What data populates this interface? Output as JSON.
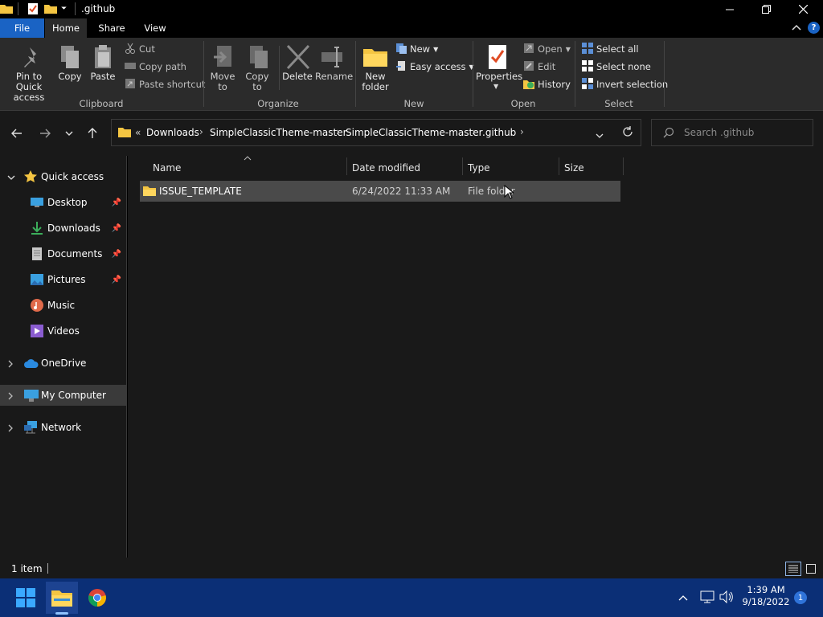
{
  "window": {
    "title": ".github"
  },
  "ribbon_tabs": {
    "file": "File",
    "home": "Home",
    "share": "Share",
    "view": "View"
  },
  "ribbon": {
    "clipboard": {
      "group": "Clipboard",
      "pin": "Pin to Quick access",
      "pin_l1": "Pin to Quick",
      "pin_l2": "access",
      "copy": "Copy",
      "paste": "Paste",
      "cut": "Cut",
      "copy_path": "Copy path",
      "paste_shortcut": "Paste shortcut"
    },
    "organize": {
      "group": "Organize",
      "move_l1": "Move",
      "move_l2": "to",
      "copy_l1": "Copy",
      "copy_l2": "to",
      "delete": "Delete",
      "rename": "Rename"
    },
    "new": {
      "group": "New",
      "new_folder_l1": "New",
      "new_folder_l2": "folder",
      "new_item": "New",
      "easy_access": "Easy access"
    },
    "open": {
      "group": "Open",
      "properties": "Properties",
      "open": "Open",
      "edit": "Edit",
      "history": "History"
    },
    "select": {
      "group": "Select",
      "select_all": "Select all",
      "select_none": "Select none",
      "invert": "Invert selection"
    }
  },
  "address": {
    "crumbs": [
      "Downloads",
      "SimpleClassicTheme-master",
      "SimpleClassicTheme-master",
      ".github"
    ],
    "overflow": "«"
  },
  "search": {
    "placeholder": "Search .github"
  },
  "nav": {
    "quick_access": "Quick access",
    "items": [
      "Desktop",
      "Downloads",
      "Documents",
      "Pictures",
      "Music",
      "Videos"
    ],
    "onedrive": "OneDrive",
    "my_computer": "My Computer",
    "network": "Network"
  },
  "columns": {
    "name": "Name",
    "date": "Date modified",
    "type": "Type",
    "size": "Size"
  },
  "files": [
    {
      "name": "ISSUE_TEMPLATE",
      "date": "6/24/2022 11:33 AM",
      "type": "File folder",
      "size": ""
    }
  ],
  "status": {
    "count": "1 item"
  },
  "taskbar": {
    "time": "1:39 AM",
    "date": "9/18/2022",
    "notif_count": "1"
  },
  "colors": {
    "accent": "#1a63c4",
    "taskbar": "#0b2f76",
    "folder": "#f4c542"
  }
}
